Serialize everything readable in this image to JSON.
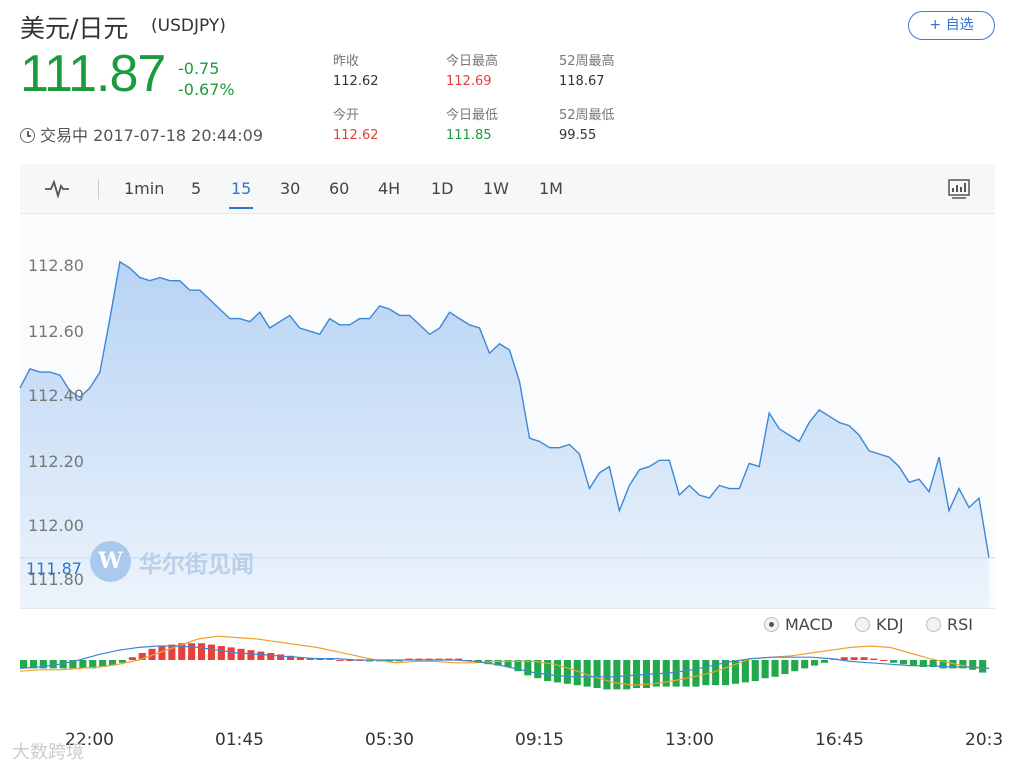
{
  "header": {
    "title": "美元/日元",
    "code": "(USDJPY)",
    "fav_label": "+ 自选",
    "price": "111.87",
    "change": "-0.75",
    "change_pct": "-0.67%",
    "status": "交易中 2017-07-18 20:44:09"
  },
  "stats": [
    {
      "key": "昨收",
      "value": "112.62"
    },
    {
      "key": "今日最高",
      "value": "112.69"
    },
    {
      "key": "52周最高",
      "value": "118.67"
    },
    {
      "key": "今开",
      "value": "112.62"
    },
    {
      "key": "今日最低",
      "value": "111.85"
    },
    {
      "key": "52周最低",
      "value": "99.55"
    }
  ],
  "tabs": [
    "1min",
    "5",
    "15",
    "30",
    "60",
    "4H",
    "1D",
    "1W",
    "1M"
  ],
  "active_tab": "15",
  "indicators": [
    "MACD",
    "KDJ",
    "RSI"
  ],
  "active_indicator": "MACD",
  "watermark": {
    "logo": "W",
    "text": "华尔街见闻"
  },
  "footer": "大数跨境",
  "chart_data": {
    "type": "area",
    "y_ticks": [
      "112.80",
      "112.60",
      "112.40",
      "112.20",
      "112.00",
      "111.80"
    ],
    "ylim": [
      111.78,
      112.85
    ],
    "last_price_label": "111.87",
    "x_ticks": [
      "22:00",
      "01:45",
      "05:30",
      "09:15",
      "13:00",
      "16:45",
      "20:3"
    ],
    "values": [
      112.41,
      112.47,
      112.46,
      112.46,
      112.45,
      112.4,
      112.38,
      112.41,
      112.46,
      112.63,
      112.81,
      112.79,
      112.76,
      112.75,
      112.76,
      112.75,
      112.75,
      112.72,
      112.72,
      112.69,
      112.66,
      112.63,
      112.63,
      112.62,
      112.65,
      112.6,
      112.62,
      112.64,
      112.6,
      112.59,
      112.58,
      112.63,
      112.61,
      112.61,
      112.63,
      112.63,
      112.67,
      112.66,
      112.64,
      112.64,
      112.61,
      112.58,
      112.6,
      112.65,
      112.63,
      112.61,
      112.6,
      112.52,
      112.55,
      112.53,
      112.43,
      112.25,
      112.24,
      112.22,
      112.22,
      112.23,
      112.2,
      112.09,
      112.14,
      112.16,
      112.02,
      112.1,
      112.15,
      112.16,
      112.18,
      112.18,
      112.07,
      112.1,
      112.07,
      112.06,
      112.1,
      112.09,
      112.09,
      112.17,
      112.16,
      112.33,
      112.28,
      112.26,
      112.24,
      112.3,
      112.34,
      112.32,
      112.3,
      112.29,
      112.26,
      112.21,
      112.2,
      112.19,
      112.16,
      112.11,
      112.12,
      112.08,
      112.19,
      112.02,
      112.09,
      112.03,
      112.06,
      111.87
    ],
    "macd_hist": [
      -0.6,
      -0.6,
      -0.6,
      -0.6,
      -0.6,
      -0.6,
      -0.6,
      -0.6,
      -0.5,
      -0.4,
      -0.2,
      0.2,
      0.5,
      0.8,
      1.0,
      1.1,
      1.2,
      1.2,
      1.2,
      1.1,
      1.0,
      0.9,
      0.8,
      0.7,
      0.6,
      0.5,
      0.4,
      0.3,
      0.2,
      0.1,
      0.1,
      0.1,
      0.0,
      0.0,
      0.0,
      -0.1,
      -0.1,
      -0.1,
      -0.1,
      0.1,
      0.1,
      0.1,
      0.1,
      0.1,
      0.1,
      0.0,
      -0.2,
      -0.3,
      -0.4,
      -0.5,
      -0.8,
      -1.1,
      -1.3,
      -1.5,
      -1.6,
      -1.7,
      -1.8,
      -1.9,
      -2.0,
      -2.1,
      -2.1,
      -2.1,
      -2.0,
      -2.0,
      -1.9,
      -1.9,
      -1.9,
      -1.9,
      -1.9,
      -1.8,
      -1.8,
      -1.8,
      -1.7,
      -1.6,
      -1.5,
      -1.3,
      -1.2,
      -1.0,
      -0.8,
      -0.6,
      -0.4,
      -0.2,
      0.1,
      0.2,
      0.2,
      0.2,
      0.1,
      0.0,
      -0.2,
      -0.3,
      -0.4,
      -0.5,
      -0.5,
      -0.6,
      -0.6,
      -0.6,
      -0.7,
      -0.9
    ],
    "macd_dif": [
      -0.8,
      -0.7,
      -0.7,
      -0.6,
      -0.5,
      -0.3,
      0.0,
      0.5,
      1.0,
      1.5,
      1.7,
      1.6,
      1.5,
      1.3,
      1.1,
      0.9,
      0.6,
      0.3,
      0.0,
      -0.2,
      -0.1,
      -0.1,
      -0.2,
      -0.2,
      -0.1,
      -0.1,
      -0.1,
      -0.3,
      -0.7,
      -1.2,
      -1.6,
      -1.8,
      -1.7,
      -1.5,
      -1.2,
      -0.9,
      -0.4,
      0.1,
      0.2,
      0.3,
      0.5,
      0.7,
      0.9,
      1.0,
      0.9,
      0.5,
      0.1,
      -0.2,
      -0.5,
      -0.6
    ],
    "macd_dea": [
      -0.6,
      -0.5,
      -0.3,
      0.0,
      0.4,
      0.7,
      0.9,
      1.0,
      1.0,
      0.9,
      0.7,
      0.5,
      0.4,
      0.3,
      0.2,
      0.1,
      0.1,
      0.0,
      0.0,
      0.0,
      0.0,
      0.0,
      0.0,
      -0.1,
      -0.3,
      -0.6,
      -0.9,
      -1.1,
      -1.2,
      -1.2,
      -1.2,
      -1.1,
      -1.0,
      -0.9,
      -0.7,
      -0.4,
      -0.1,
      0.1,
      0.2,
      0.2,
      0.2,
      0.1,
      -0.1,
      -0.2,
      -0.3,
      -0.4,
      -0.4,
      -0.5,
      -0.5,
      -0.6
    ]
  }
}
